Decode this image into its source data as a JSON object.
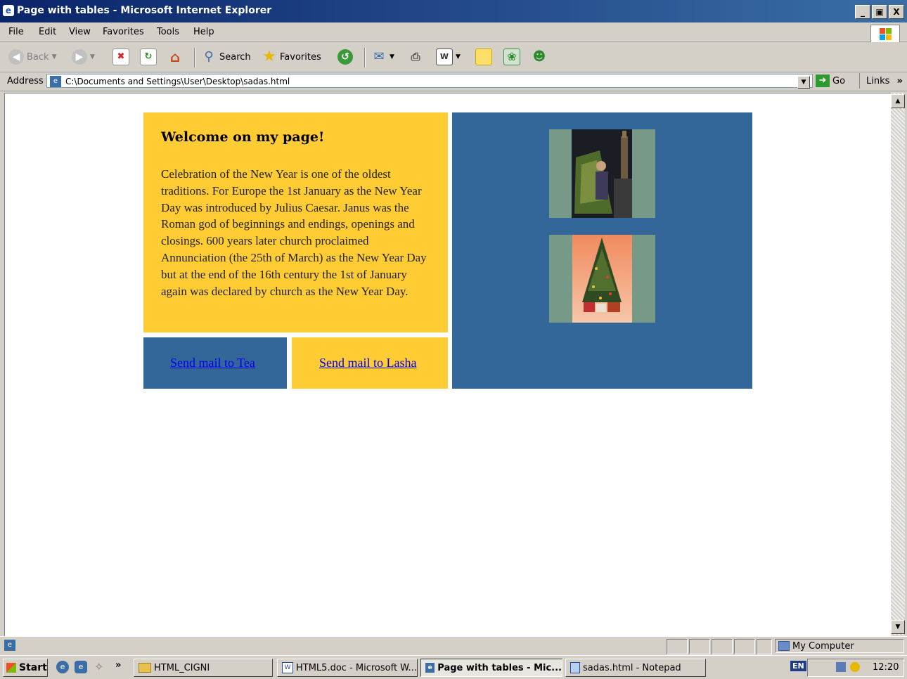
{
  "window": {
    "title": "Page with tables - Microsoft Internet Explorer",
    "min": "_",
    "max": "▣",
    "close": "X"
  },
  "menu": [
    "File",
    "Edit",
    "View",
    "Favorites",
    "Tools",
    "Help"
  ],
  "toolbar": {
    "back": "Back",
    "search": "Search",
    "favorites": "Favorites"
  },
  "address": {
    "label": "Address",
    "url": "C:\\Documents and Settings\\User\\Desktop\\sadas.html",
    "go": "Go",
    "links": "Links"
  },
  "page": {
    "heading": "Welcome on my page!",
    "paragraph": "Celebration of the New Year is one of the oldest traditions. For Europe the 1st January as the New Year Day was introduced by Julius Caesar. Janus was the Roman god of beginnings and endings, openings and closings. 600 years later church proclaimed Annunciation (the 25th of March) as the New Year Day but at the end of the 16th century the 1st of January again was declared by church as the New Year Day.",
    "mail1": "Send mail to Tea",
    "mail2": "Send mail to Lasha",
    "colors": {
      "yellow": "#ffcc33",
      "blue": "#336699",
      "frame": "#779988"
    }
  },
  "status": {
    "zone": "My Computer"
  },
  "taskbar": {
    "start": "Start",
    "chevron": "»",
    "tasks": [
      "HTML_CIGNI",
      "HTML5.doc - Microsoft W...",
      "Page with tables - Mic...",
      "sadas.html - Notepad"
    ],
    "lang": "EN",
    "time": "12:20"
  }
}
